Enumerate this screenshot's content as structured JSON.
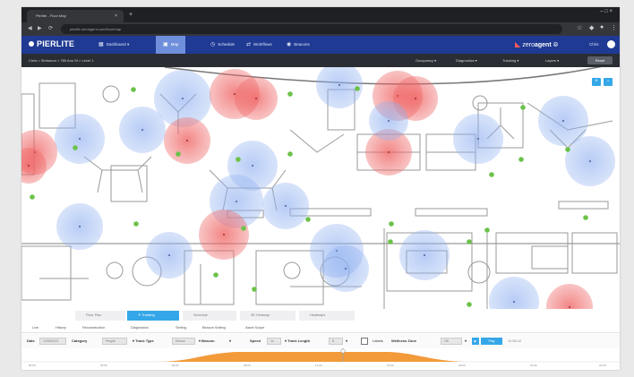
{
  "browser": {
    "tab_title": "Pierlite - Floor Map",
    "tab_close": "×",
    "new_tab": "+",
    "url": "pierlite.zeroagent.com/floor/map",
    "window_controls": "– □ ×"
  },
  "app": {
    "logo": "PIERLITE",
    "nav": [
      {
        "label": "Dashboard",
        "icon": "grid-icon"
      },
      {
        "label": "Map",
        "icon": "map-icon",
        "active": true
      },
      {
        "label": "Schedule",
        "icon": "clock-icon"
      },
      {
        "label": "Workflows",
        "icon": "workflow-icon"
      },
      {
        "label": "Beacons",
        "icon": "beacon-icon"
      }
    ],
    "brand_prefix": "zero",
    "brand_suffix": "agent",
    "user": "Chris"
  },
  "breadcrumb": {
    "path": "Chris  >  Sintracon  >  789 Ann St  >  Level 1",
    "menus": [
      "Occupancy",
      "Diagnostics",
      "Tracking",
      "Layers"
    ],
    "view_button": "Reset"
  },
  "map": {
    "zoom_in": "+",
    "zoom_out": "−",
    "colors": {
      "cold": "#8fb0f0",
      "hot": "#ef6b6b",
      "sensor": "#6cc24a",
      "walls": "#9a9a9a"
    }
  },
  "view_tabs": [
    {
      "label": "Floor Plan",
      "active": false
    },
    {
      "label": "Tracking",
      "active": true
    },
    {
      "label": "Schedule",
      "active": false
    },
    {
      "label": "3D Heatmap",
      "active": false
    },
    {
      "label": "Heatmaps",
      "active": false
    }
  ],
  "sub_tabs": [
    "Live",
    "History",
    "Reconstruction",
    "Diagnostics",
    "Setting",
    "Beacon Setting",
    "Asset Scope"
  ],
  "filters": {
    "date_label": "Date",
    "date_value": "13/05/2021",
    "category_label": "Category",
    "category_value": "People",
    "track_type_label": "Track Type",
    "track_type_value": "Device",
    "beacon_label": "Beacon",
    "speed_label": "Speed",
    "speed_value": "1x",
    "track_length_label": "Track Length",
    "track_length_value": "5",
    "labels_label": "Labels",
    "wellness_label": "Wellness Zone",
    "wellness_value": "Off",
    "play_button": "Play",
    "time_readout": "11:58:12"
  },
  "timeline": {
    "ticks": [
      "00:00",
      "03:00",
      "06:00",
      "09:00",
      "12:00",
      "15:00",
      "18:00",
      "21:00",
      "24:00"
    ],
    "color": "#f39a3a"
  }
}
